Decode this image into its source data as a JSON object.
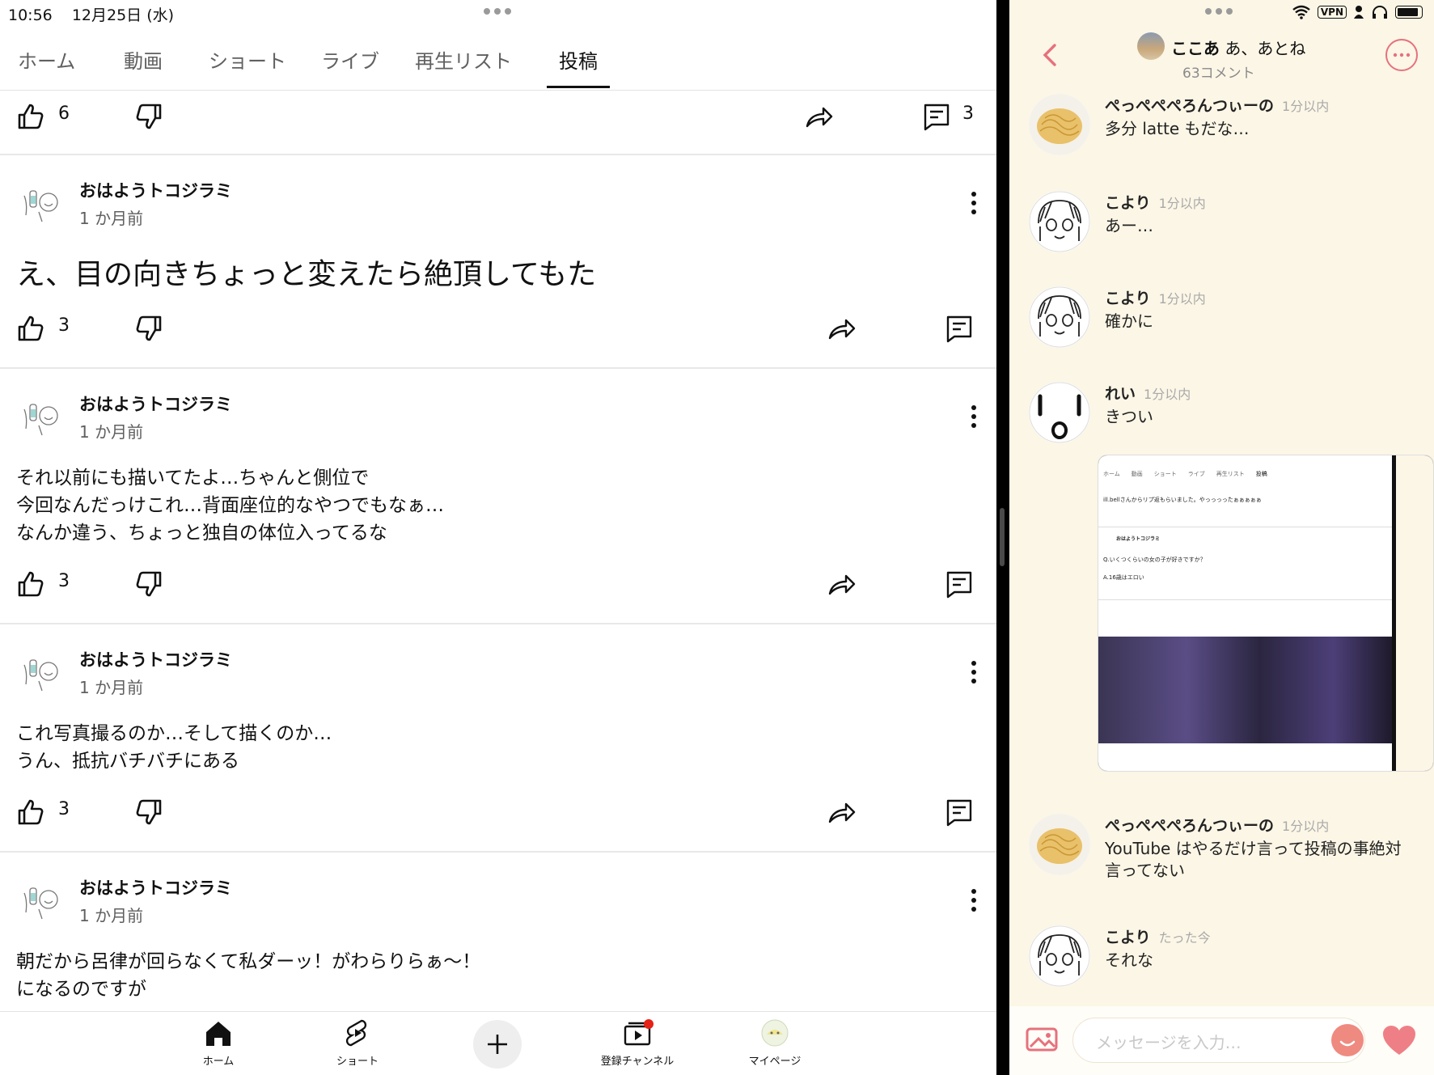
{
  "status": {
    "time": "10:56",
    "date": "12月25日 (水)",
    "vpn": "VPN"
  },
  "tabs": [
    "ホーム",
    "動画",
    "ショート",
    "ライブ",
    "再生リスト",
    "投稿"
  ],
  "active_tab": "投稿",
  "first_actions": {
    "likes": "6",
    "comments": "3"
  },
  "posts": [
    {
      "author": "おはようトコジラミ",
      "time": "1 か月前",
      "text": "え、目の向きちょっと変えたら絶頂してもた",
      "likes": "3"
    },
    {
      "author": "おはようトコジラミ",
      "time": "1 か月前",
      "text": "それ以前にも描いてたよ…ちゃんと側位で\n今回なんだっけこれ…背面座位的なやつでもなぁ…\nなんか違う、ちょっと独自の体位入ってるな",
      "likes": "3"
    },
    {
      "author": "おはようトコジラミ",
      "time": "1 か月前",
      "text": "これ写真撮るのか…そして描くのか…\nうん、抵抗バチバチにある",
      "likes": "3"
    },
    {
      "author": "おはようトコジラミ",
      "time": "1 か月前",
      "text": "朝だから呂律が回らなくて私ダーッ！がわらりらぁ〜！\nになるのですが",
      "likes": ""
    }
  ],
  "bottom_nav": {
    "home": "ホーム",
    "shorts": "ショート",
    "subscriptions": "登録チャンネル",
    "mypage": "マイページ"
  },
  "chat": {
    "title_bold": "ここあ",
    "title_rest": "あ、あとね",
    "subtitle": "63コメント",
    "messages": [
      {
        "name": "ぺっぺぺぺろんつぃーの",
        "time": "1分以内",
        "text": "多分 latte もだな…",
        "avatar": "pasta"
      },
      {
        "name": "こより",
        "time": "1分以内",
        "text": "あー…",
        "avatar": "sketch"
      },
      {
        "name": "こより",
        "time": "1分以内",
        "text": "確かに",
        "avatar": "sketch"
      },
      {
        "name": "れい",
        "time": "1分以内",
        "text": "きつい",
        "avatar": "face"
      },
      {
        "name": "ぺっぺぺぺろんつぃーの",
        "time": "1分以内",
        "text": "YouTube はやるだけ言って投稿の事絶対\n言ってない",
        "avatar": "pasta"
      },
      {
        "name": "こより",
        "time": "たった今",
        "text": "それな",
        "avatar": "sketch"
      }
    ],
    "input_placeholder": "メッセージを入力…"
  },
  "screenshot_thumb": {
    "tabs": [
      "ホーム",
      "動画",
      "ショート",
      "ライブ",
      "再生リスト",
      "投稿"
    ],
    "line1": "ill.bellさんからリプ返もらいました。やっっっったぁぁぁぁぁ",
    "author": "おはようトコジラミ",
    "q": "Q.いくつくらいの女の子が好きですか？",
    "a": "A.16歳はエロい"
  },
  "colors": {
    "accent_pink": "#e6717d",
    "chat_bg": "#fcf6e6",
    "notification_dot": "#e62117"
  }
}
